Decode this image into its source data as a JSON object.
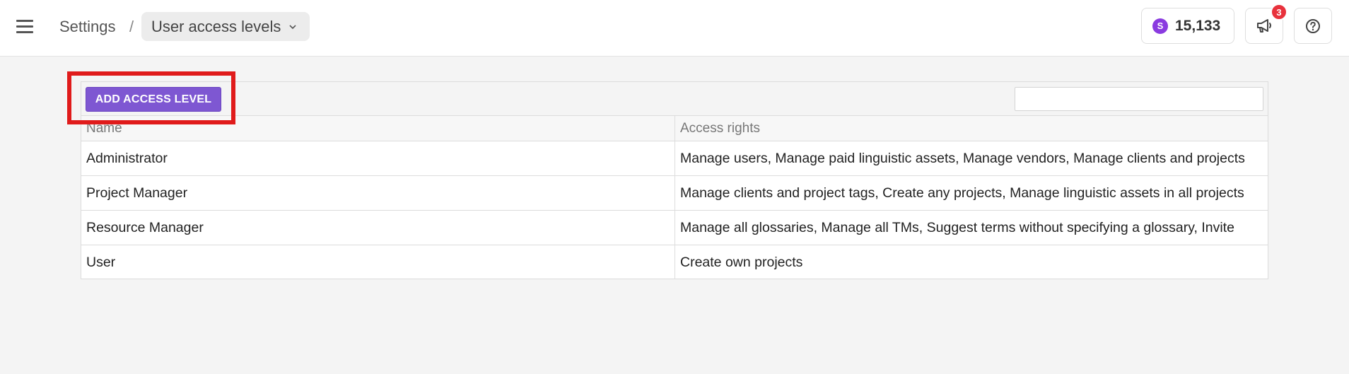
{
  "header": {
    "menu_icon": "hamburger-menu-icon",
    "breadcrumb_root": "Settings",
    "breadcrumb_separator": "/",
    "breadcrumb_current": "User access levels",
    "credits_icon_letter": "S",
    "credits_value": "15,133",
    "announcements_icon": "megaphone-icon",
    "notifications_count": "3",
    "help_icon": "help-circle-icon"
  },
  "toolbar": {
    "add_label": "ADD ACCESS LEVEL",
    "search_value": ""
  },
  "table": {
    "columns": [
      "Name",
      "Access rights"
    ],
    "rows": [
      {
        "name": "Administrator",
        "rights": "Manage users, Manage paid linguistic assets, Manage vendors, Manage clients and projects"
      },
      {
        "name": "Project Manager",
        "rights": "Manage clients and project tags, Create any projects, Manage linguistic assets in all projects"
      },
      {
        "name": "Resource Manager",
        "rights": "Manage all glossaries, Manage all TMs, Suggest terms without specifying a glossary, Invite"
      },
      {
        "name": "User",
        "rights": "Create own projects"
      }
    ]
  },
  "colors": {
    "accent": "#7e57d2",
    "highlight": "#e01b1b",
    "badge": "#e8323c",
    "credit_dot": "#8a3be0"
  }
}
